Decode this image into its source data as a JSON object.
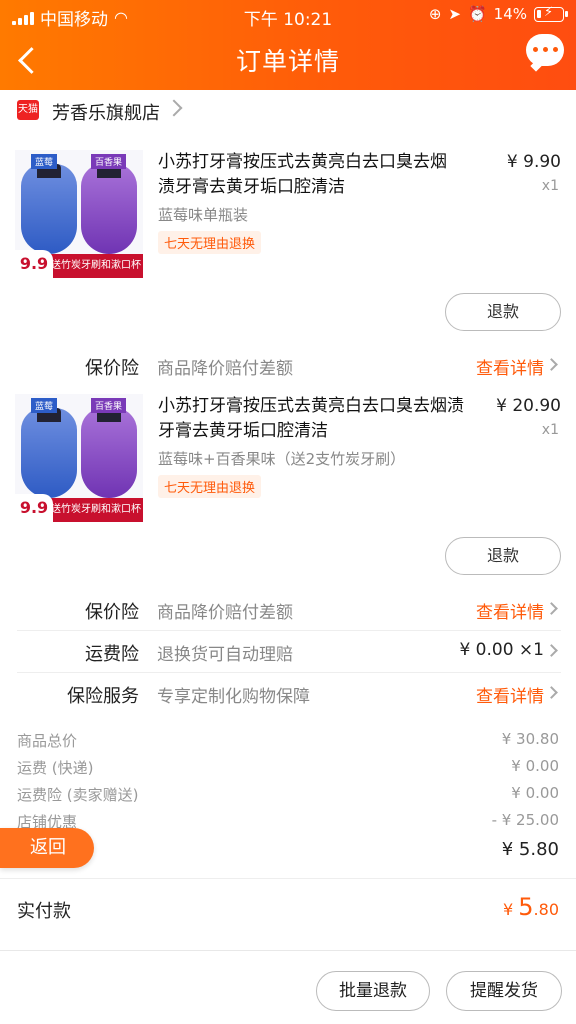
{
  "status_bar": {
    "carrier": "中国移动",
    "time": "下午 10:21",
    "battery": "14%"
  },
  "header": {
    "title": "订单详情"
  },
  "store": {
    "badge": "天猫",
    "name": "芳香乐旗舰店"
  },
  "items": [
    {
      "title": "小苏打牙膏按压式去黄亮白去口臭去烟渍牙膏去黄牙垢口腔清洁",
      "price": "¥ 9.90",
      "qty": "x1",
      "sku": "蓝莓味单瓶装",
      "tag": "七天无理由退换",
      "refund_label": "退款",
      "thumb": {
        "tag_a": "蓝莓",
        "tag_b": "百香果",
        "price": "9.9",
        "banner": "送竹炭牙刷和漱口杯"
      }
    },
    {
      "title": "小苏打牙膏按压式去黄亮白去口臭去烟渍牙膏去黄牙垢口腔清洁",
      "price": "¥ 20.90",
      "qty": "x1",
      "sku": "蓝莓味+百香果味（送2支竹炭牙刷）",
      "tag": "七天无理由退换",
      "refund_label": "退款",
      "thumb": {
        "tag_a": "蓝莓",
        "tag_b": "百香果",
        "price": "9.9",
        "banner": "送竹炭牙刷和漱口杯"
      }
    }
  ],
  "insurance": {
    "price_protect_1": {
      "label": "保价险",
      "desc": "商品降价赔付差额",
      "action": "查看详情"
    },
    "price_protect_2": {
      "label": "保价险",
      "desc": "商品降价赔付差额",
      "action": "查看详情"
    },
    "shipping_ins": {
      "label": "运费险",
      "desc": "退换货可自动理赔",
      "action": "¥ 0.00 ×1"
    },
    "service": {
      "label": "保险服务",
      "desc": "专享定制化购物保障",
      "action": "查看详情"
    }
  },
  "summary": {
    "rows": [
      {
        "k": "商品总价",
        "v": "¥ 30.80"
      },
      {
        "k": "运费 (快递)",
        "v": "¥ 0.00"
      },
      {
        "k": "运费险 (卖家赠送)",
        "v": "¥ 0.00"
      },
      {
        "k": "店铺优惠",
        "v": "- ¥ 25.00"
      }
    ],
    "subtotal": "¥ 5.80"
  },
  "back_float": "返回",
  "paid": {
    "label": "实付款",
    "currency": "¥ ",
    "int": "5",
    "dec": ".80"
  },
  "bottom": {
    "batch_refund": "批量退款",
    "remind_ship": "提醒发货"
  },
  "colors": {
    "accent": "#ff5a0a",
    "header_start": "#ff7a00",
    "header_end": "#ff4d10"
  }
}
